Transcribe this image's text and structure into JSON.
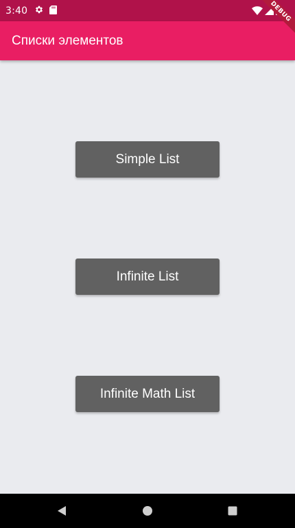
{
  "status_bar": {
    "time": "3:40",
    "icons_left": [
      "gear-icon",
      "sd-card-icon"
    ],
    "icons_right": [
      "wifi-icon",
      "signal-icon",
      "battery-icon"
    ]
  },
  "debug_banner": {
    "label": "DEBUG"
  },
  "app_bar": {
    "title": "Списки элементов",
    "color": "#e91e63"
  },
  "buttons": [
    {
      "label": "Simple List"
    },
    {
      "label": "Infinite List"
    },
    {
      "label": "Infinite Math List"
    }
  ],
  "nav_bar": {
    "icons": [
      "back-icon",
      "home-icon",
      "recents-icon"
    ]
  },
  "colors": {
    "status_bar": "#b0124a",
    "app_bar": "#e91e63",
    "button": "#616161",
    "background": "#eaebef"
  }
}
